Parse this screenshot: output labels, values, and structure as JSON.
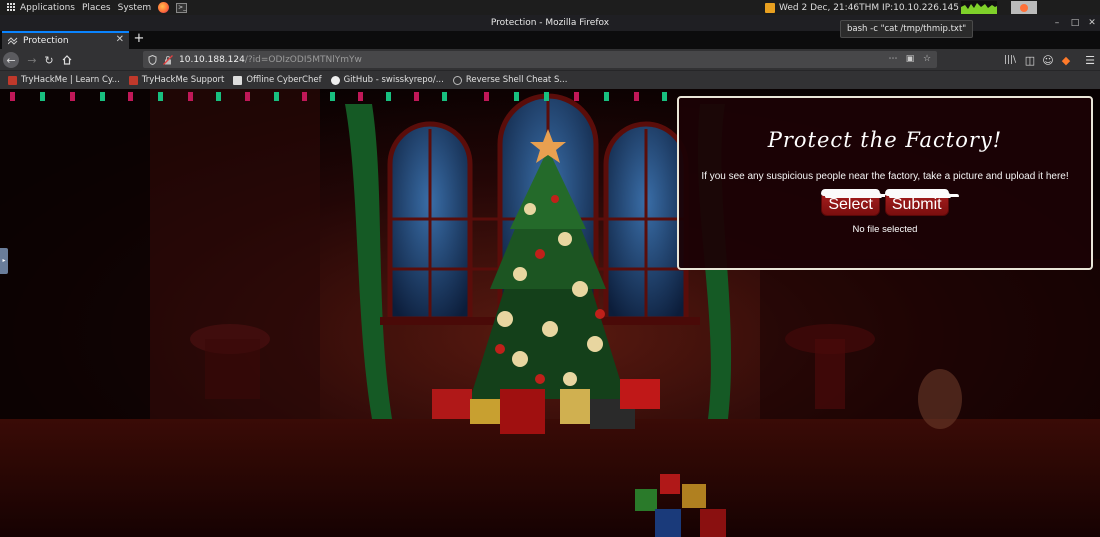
{
  "panel": {
    "applications": "Applications",
    "places": "Places",
    "system": "System",
    "clock": "Wed  2 Dec, 21:46",
    "ip_text": "THM IP:10.10.226.145"
  },
  "tooltip": "bash -c \"cat /tmp/thmip.txt\"",
  "window": {
    "title": "Protection - Mozilla Firefox"
  },
  "tab": {
    "label": "Protection"
  },
  "url": {
    "host": "10.10.188.124",
    "path": "/?id=ODIzODI5MTNlYmYw"
  },
  "bookmarks": [
    {
      "label": "TryHackMe | Learn Cy...",
      "color": "#c0392b"
    },
    {
      "label": "TryHackMe Support",
      "color": "#c0392b"
    },
    {
      "label": "Offline CyberChef",
      "color": "#dddddd"
    },
    {
      "label": "GitHub - swisskyrepo/...",
      "color": "#eeeeee"
    },
    {
      "label": "Reverse Shell Cheat S...",
      "color": "#bbbbbb"
    }
  ],
  "page": {
    "heading": "Protect the Factory!",
    "message": "If you see any suspicious people near the factory, take a picture and upload it here!",
    "select_label": "Select",
    "submit_label": "Submit",
    "file_status": "No file selected"
  },
  "colors": {
    "accent": "#0a84ff",
    "button_red": "#a81f1f",
    "panel_bg": "#1c0205"
  }
}
